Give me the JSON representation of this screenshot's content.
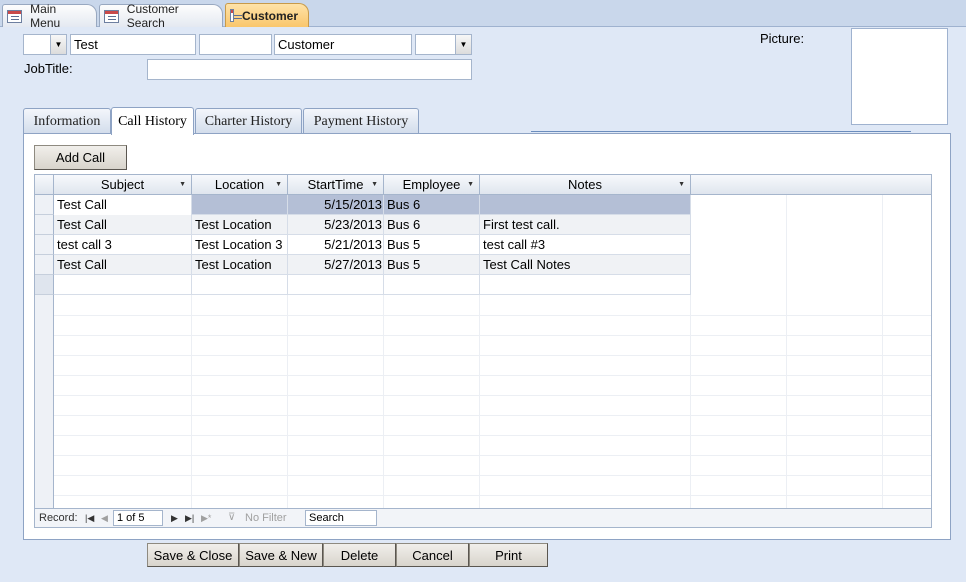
{
  "doc_tabs": [
    {
      "label": "Main Menu"
    },
    {
      "label": "Customer Search"
    },
    {
      "label": "Customer"
    }
  ],
  "header": {
    "title_value": "",
    "first_name_value": "Test",
    "middle_value": "",
    "last_name_value": "Customer",
    "suffix_value": "",
    "jobtitle_label": "JobTitle:",
    "jobtitle_value": "",
    "picture_label": "Picture:"
  },
  "form_tabs": [
    {
      "label": "Information"
    },
    {
      "label": "Call History"
    },
    {
      "label": "Charter History"
    },
    {
      "label": "Payment History"
    }
  ],
  "add_call_label": "Add Call",
  "grid": {
    "columns": [
      "Subject",
      "Location",
      "StartTime",
      "Employee",
      "Notes"
    ],
    "rows": [
      [
        "Test Call",
        "",
        "5/15/2013",
        "Bus 6",
        ""
      ],
      [
        "Test Call",
        "Test Location",
        "5/23/2013",
        "Bus 6",
        "First test call."
      ],
      [
        "test call 3",
        "Test Location 3",
        "5/21/2013",
        "Bus 5",
        "test call #3"
      ],
      [
        "Test Call",
        "Test Location",
        "5/27/2013",
        "Bus 5",
        "Test Call Notes"
      ]
    ]
  },
  "navigation": {
    "record_label": "Record:",
    "position": "1 of 5",
    "no_filter": "No Filter",
    "search_placeholder": "Search"
  },
  "footer_buttons": {
    "save_close": "Save & Close",
    "save_new": "Save & New",
    "delete": "Delete",
    "cancel": "Cancel",
    "print": "Print"
  },
  "colors": {
    "background": "#dfe8f6",
    "active_tab": "#f9c66c",
    "selected_row": "#b4bfd6"
  },
  "icons": {
    "tab": "form-icon",
    "dropdown": "chevron-down-icon",
    "first": "first-record-icon",
    "prev": "previous-record-icon",
    "next": "next-record-icon",
    "last": "last-record-icon",
    "new": "new-record-icon",
    "filter": "filter-icon"
  }
}
